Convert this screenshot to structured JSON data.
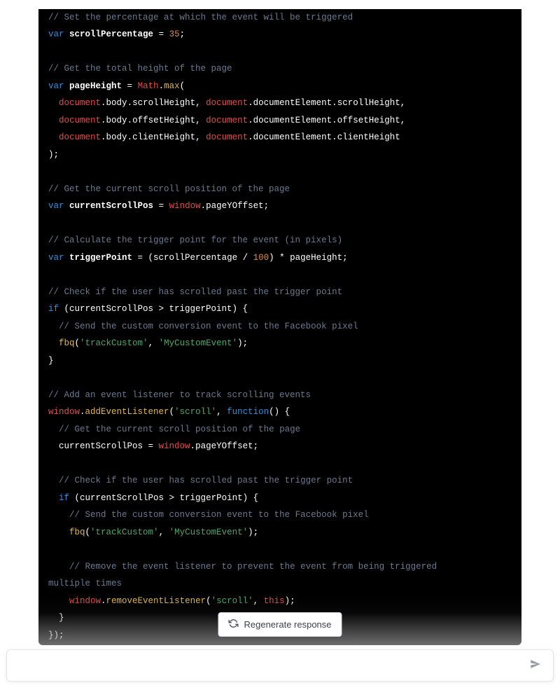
{
  "regen_button_label": "Regenerate response",
  "input_placeholder": "",
  "code": {
    "c1": "// Set the percentage at which the event will be triggered",
    "var": "var",
    "scrollPercentage": "scrollPercentage",
    "eq": " = ",
    "num35": "35",
    "semi": ";",
    "c2": "// Get the total height of the page",
    "pageHeight": "pageHeight",
    "Math": "Math",
    "dot": ".",
    "max": "max",
    "op": "(",
    "cp": ")",
    "document": "document",
    "body": "body",
    "scrollHeight": "scrollHeight",
    "documentElement": "documentElement",
    "comma": ", ",
    "offsetHeight": "offsetHeight",
    "clientHeight": "clientHeight",
    "close_paren_semi": ");",
    "c3": "// Get the current scroll position of the page",
    "currentScrollPos": "currentScrollPos",
    "window": "window",
    "pageYOffset": "pageYOffset",
    "c4": "// Calculate the trigger point for the event (in pixels)",
    "triggerPoint": "triggerPoint",
    "eq2": " = (scrollPercentage / ",
    "num100": "100",
    "after100": ") * pageHeight;",
    "c5": "// Check if the user has scrolled past the trigger point",
    "if": "if",
    "ifcond": " (currentScrollPos > triggerPoint) {",
    "c6": "// Send the custom conversion event to the Facebook pixel",
    "fbq": "fbq",
    "str_trackCustom": "'trackCustom'",
    "str_myCustomEvent": "'MyCustomEvent'",
    "closebrace": "}",
    "c7": "// Add an event listener to track scrolling events",
    "addEventListener": "addEventListener",
    "str_scroll": "'scroll'",
    "function": "function",
    "fn_open": "() {",
    "c8": "// Get the current scroll position of the page",
    "assign_csp": "  currentScrollPos = ",
    "c9": "// Check if the user has scrolled past the trigger point",
    "c10": "// Send the custom conversion event to the Facebook pixel",
    "c11": "// Remove the event listener to prevent the event from being triggered",
    "c11b": "multiple times",
    "removeEventListener": "removeEventListener",
    "this": "this",
    "close_paren_semi2": ");",
    "close_fn": "});"
  }
}
